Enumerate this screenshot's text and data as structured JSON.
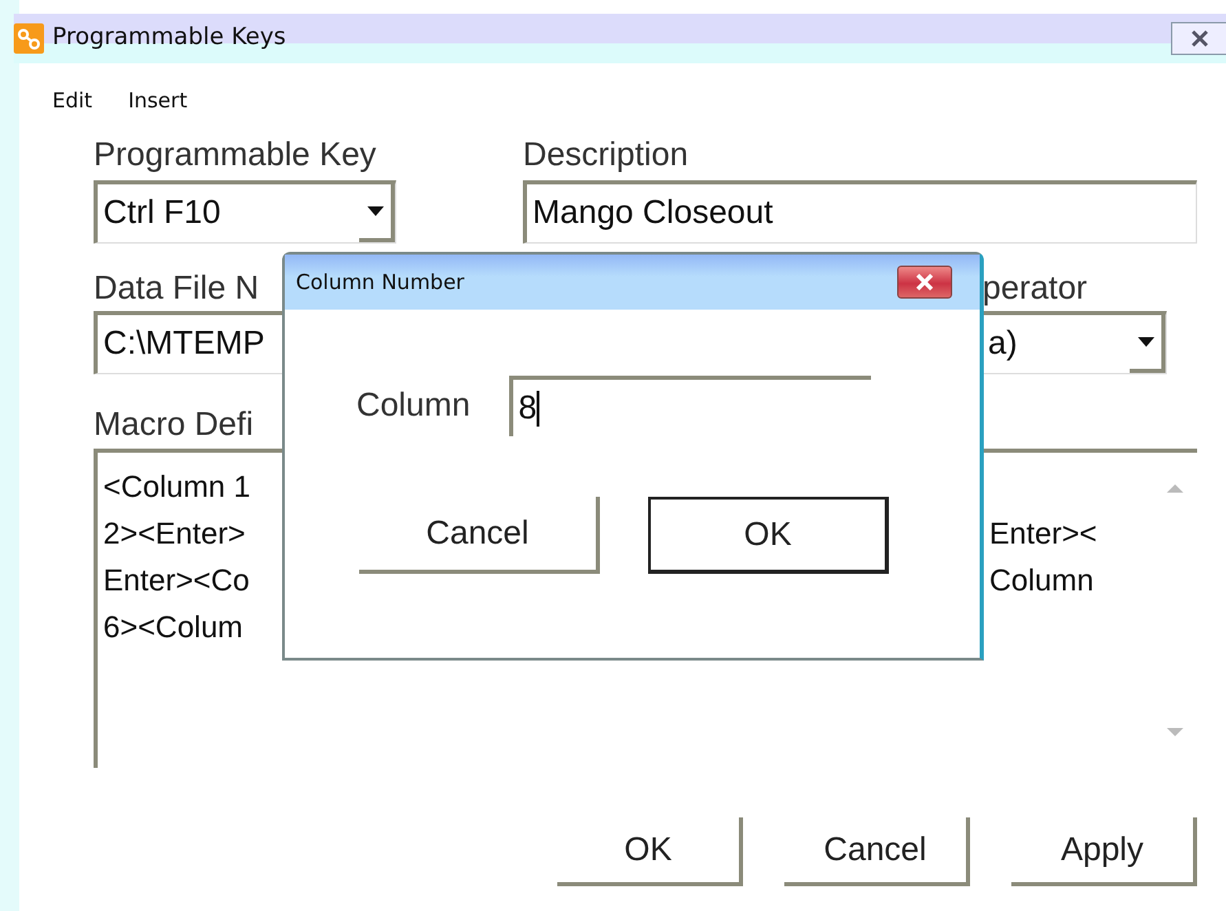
{
  "window": {
    "title": "Programmable Keys"
  },
  "menu": [
    "Edit",
    "Insert"
  ],
  "programmable_key": {
    "label": "Programmable Key",
    "value": "Ctrl F10"
  },
  "description": {
    "label": "Description",
    "value": "Mango Closeout"
  },
  "data_file": {
    "label": "Data File N",
    "value": "C:\\MTEMP"
  },
  "separator": {
    "label": "perator",
    "value": "a)"
  },
  "macro": {
    "label": "Macro Defi",
    "lines": [
      {
        "left": "<Column 1"
      },
      {
        "left": "2><Enter>",
        "right": "Enter><"
      },
      {
        "left": "Enter><Co",
        "right": "Column"
      },
      {
        "left": "6><Colum"
      }
    ]
  },
  "buttons": [
    "OK",
    "Cancel",
    "Apply"
  ],
  "dialog": {
    "title": "Column Number",
    "field": {
      "label": "Column",
      "value": "8"
    },
    "buttons": [
      {
        "label": "Cancel",
        "default": false
      },
      {
        "label": "OK",
        "default": true
      }
    ]
  }
}
